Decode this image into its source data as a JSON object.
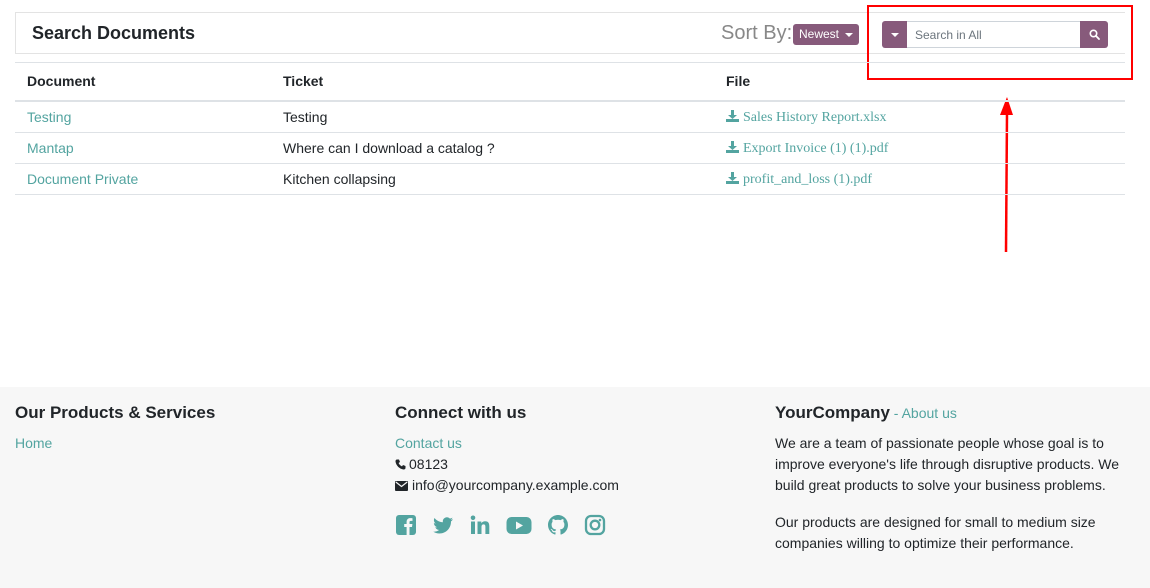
{
  "header": {
    "title": "Search Documents",
    "sort_label": "Sort By:",
    "sort_value": "Newest",
    "search_placeholder": "Search in All"
  },
  "table": {
    "headers": [
      "Document",
      "Ticket",
      "File"
    ],
    "rows": [
      {
        "document": "Testing",
        "ticket": "Testing",
        "file": "Sales History Report.xlsx"
      },
      {
        "document": "Mantap",
        "ticket": "Where can I download a catalog ?",
        "file": "Export Invoice (1) (1).pdf"
      },
      {
        "document": "Document Private",
        "ticket": "Kitchen collapsing",
        "file": "profit_and_loss (1).pdf"
      }
    ]
  },
  "footer": {
    "products": {
      "title": "Our Products & Services",
      "home": "Home"
    },
    "connect": {
      "title": "Connect with us",
      "contact": "Contact us",
      "phone": "08123",
      "email": "info@yourcompany.example.com",
      "social_icons": [
        "facebook-icon",
        "twitter-icon",
        "linkedin-icon",
        "youtube-icon",
        "github-icon",
        "instagram-icon"
      ]
    },
    "company": {
      "name": "YourCompany",
      "separator": " - ",
      "about_link": "About us",
      "para1": "We are a team of passionate people whose goal is to improve everyone's life through disruptive products. We build great products to solve your business problems.",
      "para2": "Our products are designed for small to medium size companies willing to optimize their performance."
    }
  },
  "colors": {
    "primary": "#875a7b",
    "link": "#53a4a0",
    "annotation": "#ff0000",
    "footer_bg": "#f7f7f7"
  }
}
